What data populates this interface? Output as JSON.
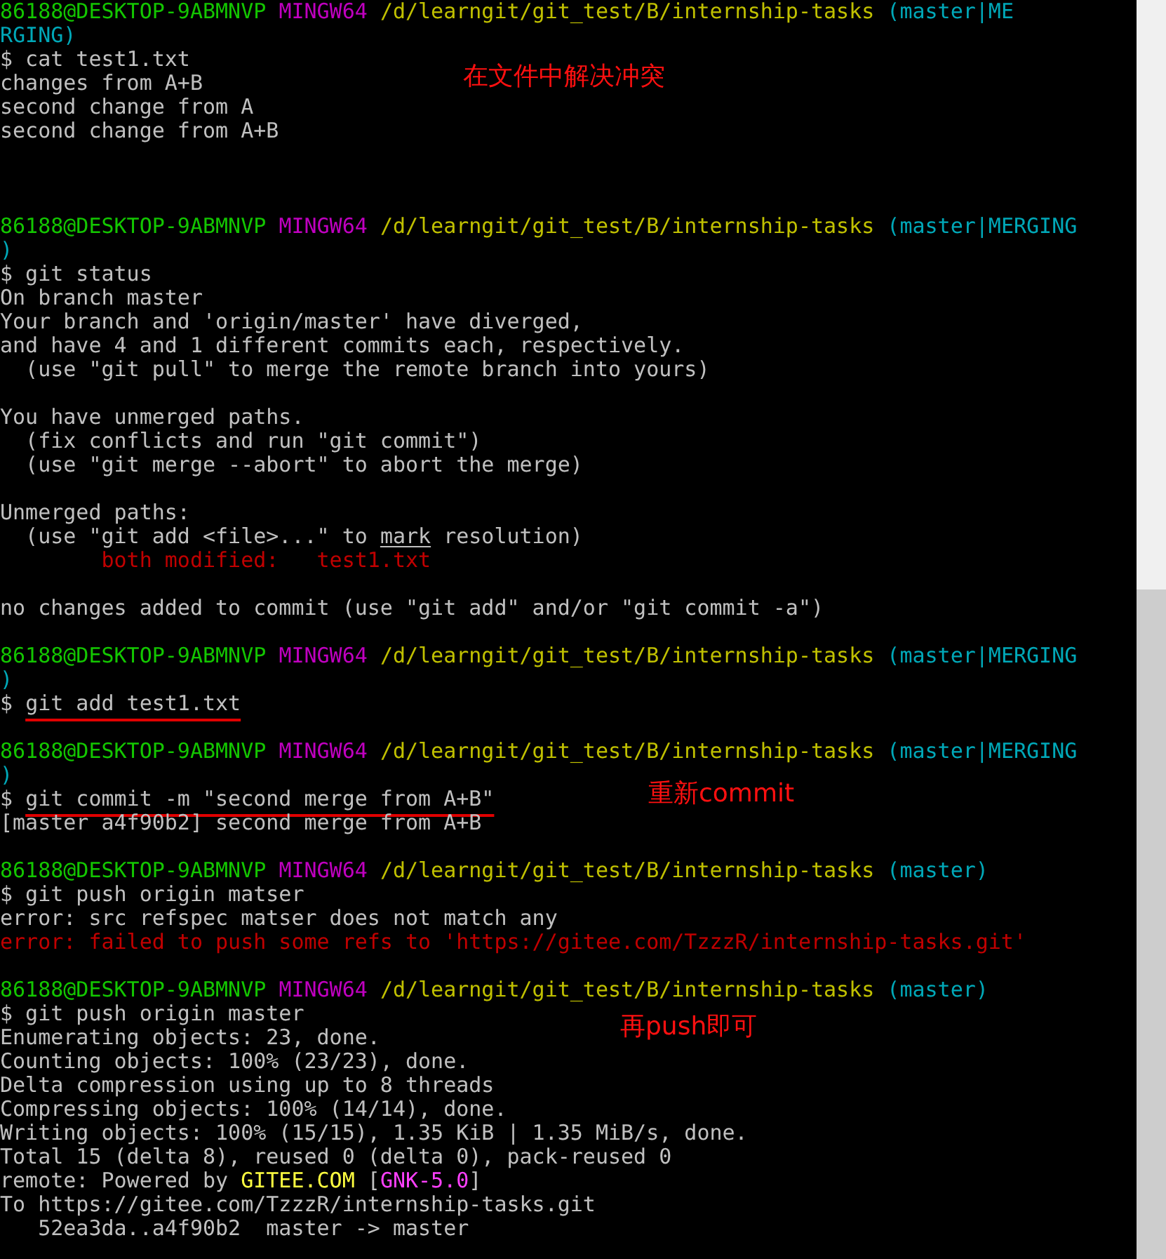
{
  "terminal": {
    "blocks": [
      {
        "lines": [
          [
            {
              "text": "86188@DESKTOP-9ABMNVP ",
              "kind": "user"
            },
            {
              "text": "MINGW64 ",
              "kind": "shell"
            },
            {
              "text": "/d/learngit/git_test/B/internship-tasks ",
              "kind": "path"
            },
            {
              "text": "(master|ME",
              "kind": "branch"
            }
          ],
          [
            {
              "text": "RGING)",
              "kind": "branch"
            }
          ],
          [
            {
              "text": "$ cat test1.txt",
              "kind": "plain"
            }
          ],
          [
            {
              "text": "changes from A+B",
              "kind": "plain"
            }
          ],
          [
            {
              "text": "second change from A",
              "kind": "plain"
            }
          ],
          [
            {
              "text": "second change from A+B",
              "kind": "plain"
            }
          ]
        ]
      },
      {
        "lines": [
          [
            {
              "text": "86188@DESKTOP-9ABMNVP ",
              "kind": "user"
            },
            {
              "text": "MINGW64 ",
              "kind": "shell"
            },
            {
              "text": "/d/learngit/git_test/B/internship-tasks ",
              "kind": "path"
            },
            {
              "text": "(master|MERGING",
              "kind": "branch"
            }
          ],
          [
            {
              "text": ")",
              "kind": "branch"
            }
          ],
          [
            {
              "text": "$ git status",
              "kind": "plain"
            }
          ],
          [
            {
              "text": "On branch master",
              "kind": "plain"
            }
          ],
          [
            {
              "text": "Your branch and 'origin/master' have diverged,",
              "kind": "plain"
            }
          ],
          [
            {
              "text": "and have 4 and 1 different commits each, respectively.",
              "kind": "plain"
            }
          ],
          [
            {
              "text": "  (use \"git pull\" to merge the remote branch into yours)",
              "kind": "plain"
            }
          ]
        ]
      },
      {
        "lines": [
          [
            {
              "text": "You have unmerged paths.",
              "kind": "plain"
            }
          ],
          [
            {
              "text": "  (fix conflicts and run \"git commit\")",
              "kind": "plain"
            }
          ],
          [
            {
              "text": "  (use \"git merge --abort\" to abort the merge)",
              "kind": "plain"
            }
          ]
        ]
      },
      {
        "lines": [
          [
            {
              "text": "Unmerged paths:",
              "kind": "plain"
            }
          ],
          [
            {
              "text": "  (use \"git add <file>...\" to ",
              "kind": "plain"
            },
            {
              "text": "mark",
              "kind": "underline"
            },
            {
              "text": " resolution)",
              "kind": "plain"
            }
          ],
          [
            {
              "text": "\tboth modified:   test1.txt",
              "kind": "error"
            }
          ]
        ]
      },
      {
        "lines": [
          [
            {
              "text": "no changes added to commit (use \"git add\" and/or \"git commit -a\")",
              "kind": "plain"
            }
          ]
        ]
      },
      {
        "lines": [
          [
            {
              "text": "86188@DESKTOP-9ABMNVP ",
              "kind": "user"
            },
            {
              "text": "MINGW64 ",
              "kind": "shell"
            },
            {
              "text": "/d/learngit/git_test/B/internship-tasks ",
              "kind": "path"
            },
            {
              "text": "(master|MERGING",
              "kind": "branch"
            }
          ],
          [
            {
              "text": ")",
              "kind": "branch"
            }
          ],
          [
            {
              "text": "$ ",
              "kind": "plain"
            },
            {
              "text": "git add test1.txt",
              "kind": "marked"
            }
          ]
        ]
      },
      {
        "lines": [
          [
            {
              "text": "86188@DESKTOP-9ABMNVP ",
              "kind": "user"
            },
            {
              "text": "MINGW64 ",
              "kind": "shell"
            },
            {
              "text": "/d/learngit/git_test/B/internship-tasks ",
              "kind": "path"
            },
            {
              "text": "(master|MERGING",
              "kind": "branch"
            }
          ],
          [
            {
              "text": ")",
              "kind": "branch"
            }
          ],
          [
            {
              "text": "$ ",
              "kind": "plain"
            },
            {
              "text": "git commit -m \"second merge from A+B\"",
              "kind": "marked"
            }
          ],
          [
            {
              "text": "[master a4f90b2] second merge from A+B",
              "kind": "plain"
            }
          ]
        ]
      },
      {
        "lines": [
          [
            {
              "text": "86188@DESKTOP-9ABMNVP ",
              "kind": "user"
            },
            {
              "text": "MINGW64 ",
              "kind": "shell"
            },
            {
              "text": "/d/learngit/git_test/B/internship-tasks ",
              "kind": "path"
            },
            {
              "text": "(master)",
              "kind": "branch"
            }
          ],
          [
            {
              "text": "$ git push origin matser",
              "kind": "plain"
            }
          ],
          [
            {
              "text": "error: src refspec matser does not match any",
              "kind": "plain"
            }
          ],
          [
            {
              "text": "error: failed to push some refs to 'https://gitee.com/TzzzR/internship-tasks.git'",
              "kind": "error"
            }
          ]
        ]
      },
      {
        "lines": [
          [
            {
              "text": "86188@DESKTOP-9ABMNVP ",
              "kind": "user"
            },
            {
              "text": "MINGW64 ",
              "kind": "shell"
            },
            {
              "text": "/d/learngit/git_test/B/internship-tasks ",
              "kind": "path"
            },
            {
              "text": "(master)",
              "kind": "branch"
            }
          ],
          [
            {
              "text": "$ git push origin master",
              "kind": "plain"
            }
          ],
          [
            {
              "text": "Enumerating objects: 23, done.",
              "kind": "plain"
            }
          ],
          [
            {
              "text": "Counting objects: 100% (23/23), done.",
              "kind": "plain"
            }
          ],
          [
            {
              "text": "Delta compression using up to 8 threads",
              "kind": "plain"
            }
          ],
          [
            {
              "text": "Compressing objects: 100% (14/14), done.",
              "kind": "plain"
            }
          ],
          [
            {
              "text": "Writing objects: 100% (15/15), 1.35 KiB | 1.35 MiB/s, done.",
              "kind": "plain"
            }
          ],
          [
            {
              "text": "Total 15 (delta 8), reused 0 (delta 0), pack-reused 0",
              "kind": "plain"
            }
          ],
          [
            {
              "text": "remote: Powered by ",
              "kind": "plain"
            },
            {
              "text": "GITEE.COM",
              "kind": "highlight"
            },
            {
              "text": " [",
              "kind": "plain"
            },
            {
              "text": "GNK-5.0",
              "kind": "tag"
            },
            {
              "text": "]",
              "kind": "plain"
            }
          ],
          [
            {
              "text": "To https://gitee.com/TzzzR/internship-tasks.git",
              "kind": "plain"
            }
          ],
          [
            {
              "text": "   52ea3da..a4f90b2  master -> master",
              "kind": "plain"
            }
          ]
        ]
      }
    ]
  },
  "notes": [
    "在文件中解决冲突",
    "重新commit",
    "再push即可"
  ]
}
